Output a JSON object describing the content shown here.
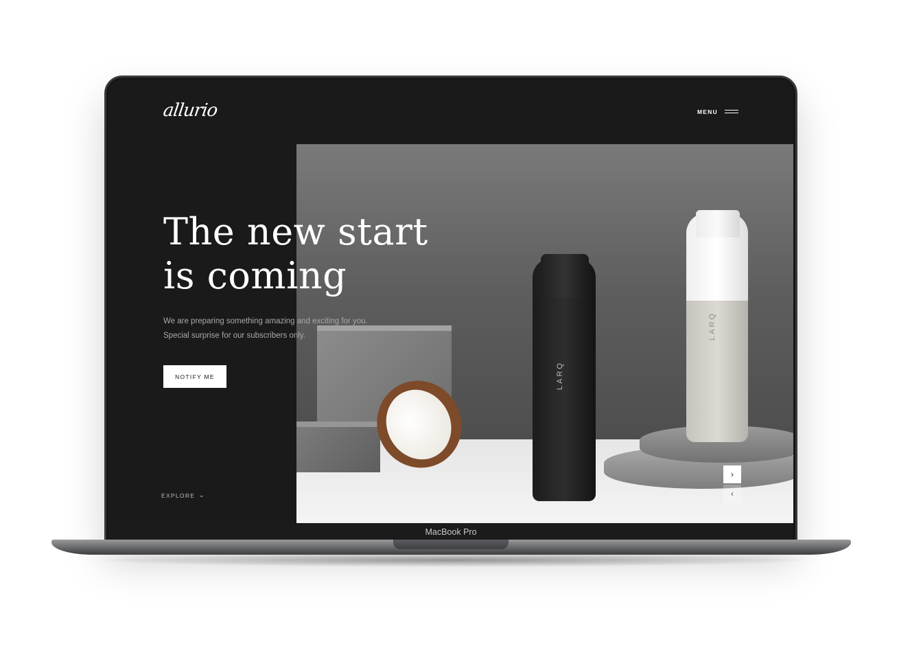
{
  "header": {
    "logo_text": "allurio",
    "menu_label": "MENU"
  },
  "hero": {
    "headline_line1": "The new start",
    "headline_line2": "is coming",
    "subtext_line1": "We are preparing something amazing and exciting for you.",
    "subtext_line2": "Special surprise for our subscribers only.",
    "notify_button": "NOTIFY ME",
    "explore_label": "EXPLORE",
    "product_brand": "LARQ"
  },
  "slider": {
    "next_icon": "chevron-right-icon",
    "prev_icon": "chevron-left-icon",
    "next_glyph": "›",
    "prev_glyph": "‹"
  },
  "device": {
    "label": "MacBook Pro"
  },
  "colors": {
    "screen_bg": "#1a1a1b",
    "text_primary": "#ffffff",
    "text_muted": "#a9a9a9",
    "button_bg": "#ffffff"
  }
}
